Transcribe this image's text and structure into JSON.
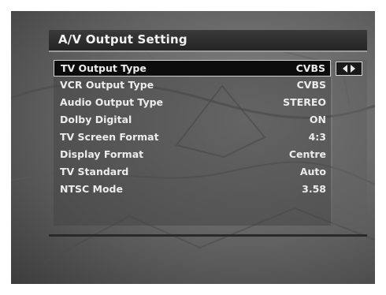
{
  "menu": {
    "title": "A/V Output Setting",
    "rows": [
      {
        "label": "TV Output Type",
        "value": "CVBS"
      },
      {
        "label": "VCR Output Type",
        "value": "CVBS"
      },
      {
        "label": "Audio Output Type",
        "value": "STEREO"
      },
      {
        "label": "Dolby Digital",
        "value": "ON"
      },
      {
        "label": "TV Screen Format",
        "value": "4:3"
      },
      {
        "label": "Display Format",
        "value": "Centre"
      },
      {
        "label": "TV Standard",
        "value": "Auto"
      },
      {
        "label": "NTSC Mode",
        "value": "3.58"
      }
    ],
    "selected_index": 0
  },
  "icons": {
    "value_selector": "left-right-arrows-icon"
  },
  "colors": {
    "title_bar": "#242424",
    "selected_row": "#0c0c0c",
    "text": "#ececec"
  }
}
